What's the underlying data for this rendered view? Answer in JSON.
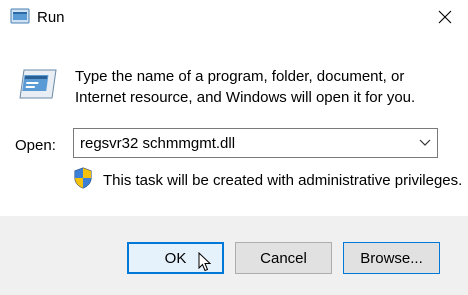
{
  "window": {
    "title": "Run"
  },
  "titlebar": {
    "app_icon": "run-icon",
    "close_icon": "close-icon"
  },
  "description": "Type the name of a program, folder, document, or Internet resource, and Windows will open it for you.",
  "open": {
    "label": "Open:",
    "value": "regsvr32 schmmgmt.dll",
    "dropdown_icon": "chevron-down-icon"
  },
  "admin_note": {
    "icon": "uac-shield-icon",
    "text": "This task will be created with administrative privileges."
  },
  "buttons": {
    "ok": "OK",
    "cancel": "Cancel",
    "browse": "Browse..."
  },
  "colors": {
    "accent": "#0078d7",
    "footer": "#f0f0f0"
  }
}
